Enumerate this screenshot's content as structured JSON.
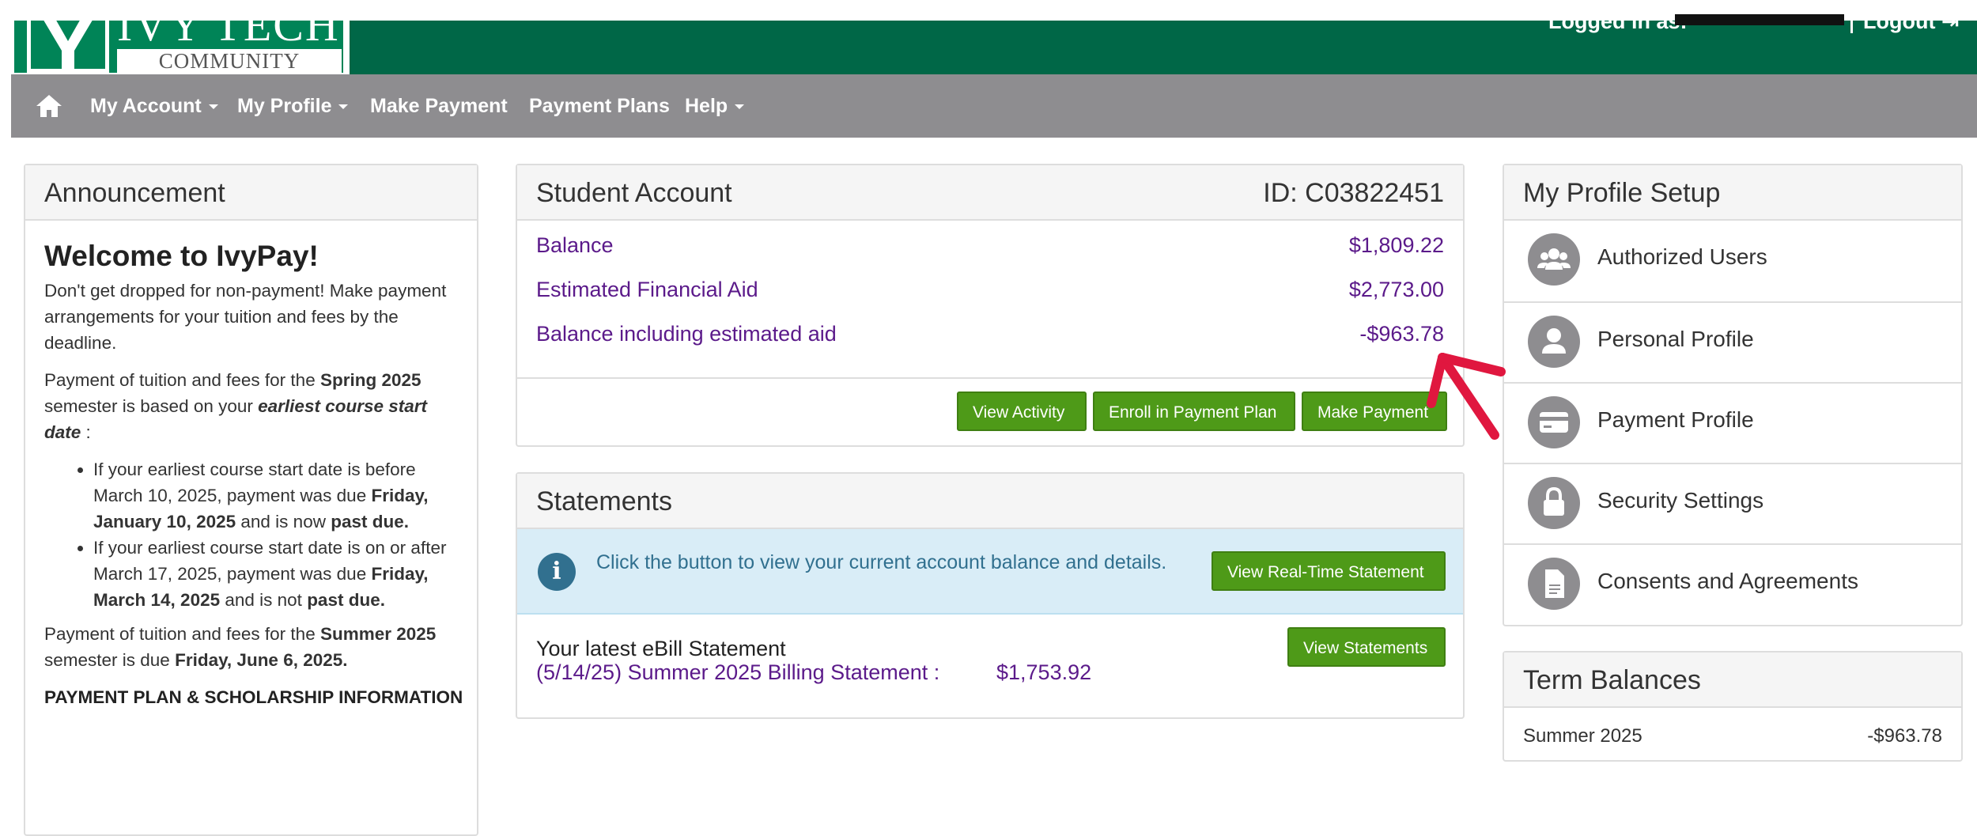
{
  "header": {
    "logo_top": "IVY TECH",
    "logo_bottom": "COMMUNITY COLLEGE",
    "logged_in_label": "Logged in as:",
    "logout_label": "Logout"
  },
  "nav": {
    "items": [
      {
        "label": "My Account",
        "dropdown": true
      },
      {
        "label": "My Profile",
        "dropdown": true
      },
      {
        "label": "Make Payment",
        "dropdown": false
      },
      {
        "label": "Payment Plans",
        "dropdown": false
      },
      {
        "label": "Help",
        "dropdown": true
      }
    ]
  },
  "announcement": {
    "title": "Announcement",
    "welcome": "Welcome to IvyPay!",
    "para1": "Don't get dropped for non-payment! Make payment arrangements for your tuition and fees by the deadline.",
    "spring_pre": "Payment of tuition and fees for the ",
    "spring_term": "Spring 2025",
    "spring_mid": " semester is based on your ",
    "spring_em": "earliest course start date",
    "spring_post": " :",
    "bullets": [
      {
        "pre": "If your earliest course start date is before March 10, 2025, payment was due ",
        "date": "Friday, January 10, 2025",
        "mid": " and is now ",
        "status": "past due."
      },
      {
        "pre": "If your earliest course start date is on or after March 17, 2025, payment was due ",
        "date": "Friday, March 14, 2025",
        "mid": " and is not ",
        "status": "past due."
      }
    ],
    "summer_pre": "Payment of tuition and fees for the ",
    "summer_term": "Summer 2025",
    "summer_mid": " semester is due ",
    "summer_date": "Friday, June 6, 2025.",
    "heading": "PAYMENT PLAN & SCHOLARSHIP INFORMATION"
  },
  "student_account": {
    "title": "Student Account",
    "id_label": "ID: C03822451",
    "rows": [
      {
        "label": "Balance",
        "value": "$1,809.22"
      },
      {
        "label": "Estimated Financial Aid",
        "value": "$2,773.00"
      },
      {
        "label": "Balance including estimated aid",
        "value": "-$963.78"
      }
    ],
    "buttons": {
      "view_activity": "View Activity",
      "enroll_plan": "Enroll in Payment Plan",
      "make_payment": "Make Payment"
    }
  },
  "statements": {
    "title": "Statements",
    "info_text": "Click the button to view your current account balance and details.",
    "realtime_button": "View Real-Time Statement",
    "view_statements_button": "View Statements",
    "latest_title": "Your latest eBill Statement",
    "latest_link": "(5/14/25) Summer 2025 Billing Statement :",
    "latest_amount": "$1,753.92"
  },
  "profile_setup": {
    "title": "My Profile Setup",
    "items": [
      {
        "label": "Authorized Users",
        "icon": "users-icon"
      },
      {
        "label": "Personal Profile",
        "icon": "person-icon"
      },
      {
        "label": "Payment Profile",
        "icon": "credit-card-icon"
      },
      {
        "label": "Security Settings",
        "icon": "lock-icon"
      },
      {
        "label": "Consents and Agreements",
        "icon": "document-icon"
      }
    ]
  },
  "term_balances": {
    "title": "Term Balances",
    "term": "Summer 2025",
    "value": "-$963.78"
  },
  "colors": {
    "header_green": "#006747",
    "nav_grey": "#8e8d90",
    "link_purple": "#5b1a8a",
    "button_green": "#4e9a18",
    "info_bg": "#d9edf7",
    "annotation_arrow": "#e0173f"
  }
}
